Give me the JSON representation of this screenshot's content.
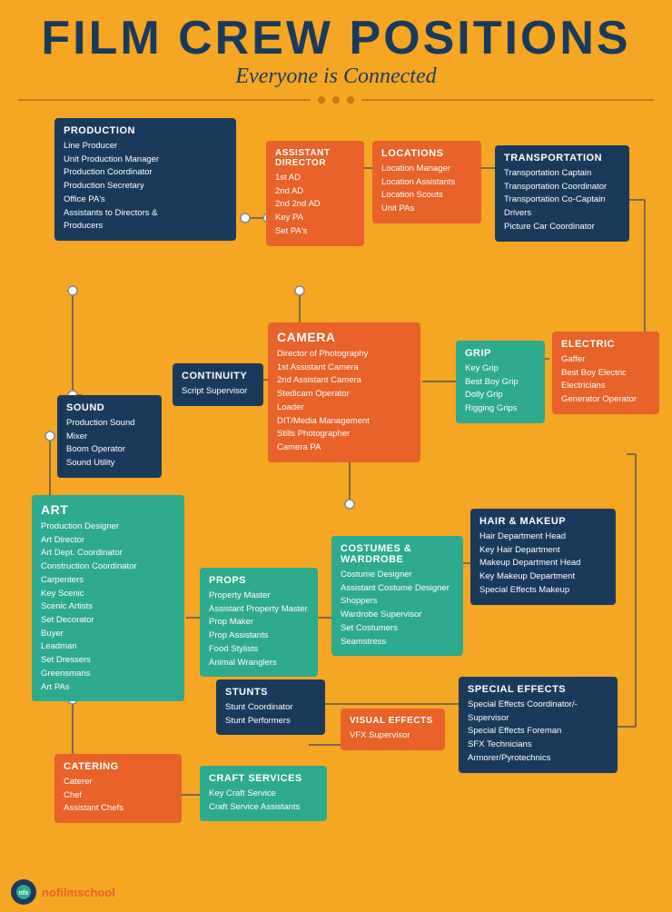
{
  "title": "FILM CREW POSITIONS",
  "subtitle": "Everyone is Connected",
  "cards": {
    "production": {
      "title": "PRODUCTION",
      "items": [
        "Line Producer",
        "Unit Production Manager",
        "Production Coordinator",
        "Production Secretary",
        "Office PA's",
        "Assistants to Directors &",
        "Producers"
      ]
    },
    "assistant_director": {
      "title": "ASSISTANT DIRECTOR",
      "items": [
        "1st AD",
        "2nd AD",
        "2nd 2nd AD",
        "Key PA",
        "Set PA's"
      ]
    },
    "locations": {
      "title": "LOCATIONS",
      "items": [
        "Location Manager",
        "Location Assistants",
        "Location Scouts",
        "Unit PAs"
      ]
    },
    "transportation": {
      "title": "TRANSPORTATION",
      "items": [
        "Transportation Captain",
        "Transportation Coordinator",
        "Transportation Co-Captain",
        "Drivers",
        "Picture Car Coordinator"
      ]
    },
    "sound": {
      "title": "SOUND",
      "items": [
        "Production Sound Mixer",
        "Boom Operator",
        "Sound Utility"
      ]
    },
    "continuity": {
      "title": "CONTINUITY",
      "items": [
        "Script Supervisor"
      ]
    },
    "camera": {
      "title": "CAMERA",
      "items": [
        "Director of Photography",
        "1st Assistant Camera",
        "2nd Assistant Camera",
        "Stedicam Operator",
        "Loader",
        "DIT/Media Management",
        "Stills Photographer",
        "Camera PA"
      ]
    },
    "grip": {
      "title": "GRIP",
      "items": [
        "Key Grip",
        "Best Boy Grip",
        "Dolly Grip",
        "Rigging Grips"
      ]
    },
    "electric": {
      "title": "ELECTRIC",
      "items": [
        "Gaffer",
        "Best Boy Electric",
        "Electricians",
        "Generator Operator"
      ]
    },
    "art": {
      "title": "ART",
      "items": [
        "Production Designer",
        "Art Director",
        "Art Dept. Coordinator",
        "Construction Coordinator",
        "Carpenters",
        "Key Scenic",
        "Scenic Artists",
        "Set Decorator",
        "Buyer",
        "Leadman",
        "Set Dressers",
        "Greensmans",
        "Art PAs"
      ]
    },
    "props": {
      "title": "PROPS",
      "items": [
        "Property Master",
        "Assistant Property Master",
        "Prop Maker",
        "Prop Assistants",
        "Food Stylists",
        "Animal Wranglers"
      ]
    },
    "costumes": {
      "title": "COSTUMES & WARDROBE",
      "items": [
        "Costume Designer",
        "Assistant Costume Designer",
        "Shoppers",
        "Wardrobe Supervisor",
        "Set Costumers",
        "Seamstress"
      ]
    },
    "hair_makeup": {
      "title": "HAIR & MAKEUP",
      "items": [
        "Hair Department Head",
        "Key Hair Department",
        "Makeup Department Head",
        "Key Makeup Department",
        "Special Effects Makeup"
      ]
    },
    "stunts": {
      "title": "STUNTS",
      "items": [
        "Stunt Coordinator",
        "Stunt Performers"
      ]
    },
    "visual_effects": {
      "title": "VISUAL EFFECTS",
      "items": [
        "VFX Supervisor"
      ]
    },
    "special_effects": {
      "title": "SPECIAL EFFECTS",
      "items": [
        "Special Effects Coordinator/-",
        "Supervisor",
        "Special Effects Foreman",
        "SFX Technicians",
        "Armorer/Pyrotechnics"
      ]
    },
    "catering": {
      "title": "CATERING",
      "items": [
        "Caterer",
        "Chef",
        "Assistant Chefs"
      ]
    },
    "craft_services": {
      "title": "CRAFT SERVICES",
      "items": [
        "Key Craft Service",
        "Craft Service Assistants"
      ]
    }
  },
  "logo": {
    "name": "nofilmschool",
    "highlight": "film"
  }
}
